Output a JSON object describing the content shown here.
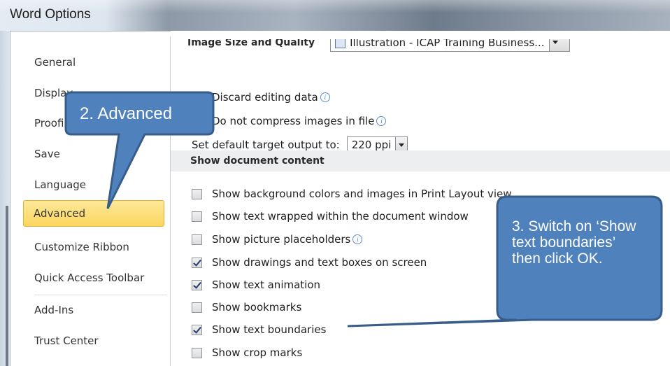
{
  "window": {
    "title": "Word Options"
  },
  "sidebar": {
    "items": [
      {
        "label": "General"
      },
      {
        "label": "Display"
      },
      {
        "label": "Proofing"
      },
      {
        "label": "Save"
      },
      {
        "label": "Language"
      },
      {
        "label": "Advanced",
        "selected": true
      },
      {
        "label": "Customize Ribbon"
      },
      {
        "label": "Quick Access Toolbar"
      },
      {
        "label": "Add-Ins"
      },
      {
        "label": "Trust Center"
      }
    ]
  },
  "image_quality": {
    "label": "Image Size and Quality",
    "document_value": "Illustration - ICAP Training Business...",
    "discard_editing_label": "Discard editing data",
    "no_compress_label": "Do not compress images in file",
    "target_output_label": "Set default target output to:",
    "target_output_value": "220 ppi"
  },
  "show_content": {
    "section_label": "Show document content",
    "options": [
      {
        "label": "Show background colors and images in Print Layout view",
        "checked": false
      },
      {
        "label": "Show text wrapped within the document window",
        "checked": false
      },
      {
        "label": "Show picture placeholders",
        "checked": false
      },
      {
        "label": "Show drawings and text boxes on screen",
        "checked": true
      },
      {
        "label": "Show text animation",
        "checked": true
      },
      {
        "label": "Show bookmarks",
        "checked": false
      },
      {
        "label": "Show text boundaries",
        "checked": true
      },
      {
        "label": "Show crop marks",
        "checked": false
      }
    ]
  },
  "callouts": {
    "advanced": "2. Advanced",
    "instruction": "3. Switch on ‘Show text boundaries’ then click OK.",
    "fill_color": "#4f81bd",
    "border_color": "#385d8a"
  },
  "colors": {
    "selected_item": "#fbd65e",
    "section_header_bg": "#eceef0"
  }
}
